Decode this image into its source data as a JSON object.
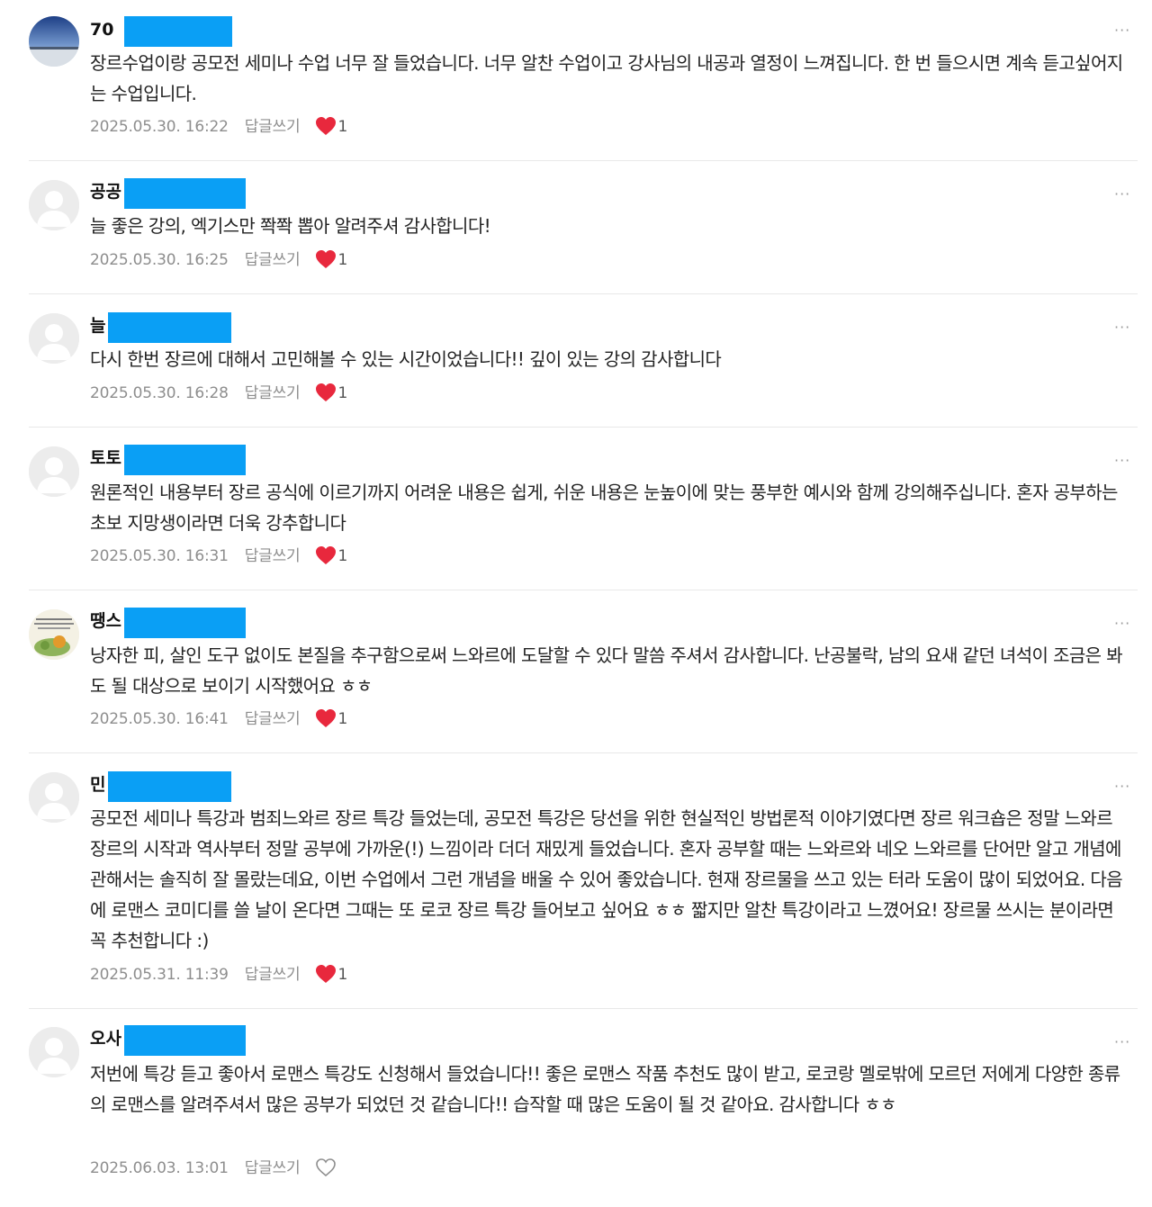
{
  "comments": [
    {
      "author": "70",
      "text": "장르수업이랑 공모전 세미나 수업 너무 잘 들었습니다. 너무 알찬 수업이고 강사님의 내공과 열정이 느껴집니다. 한 번 들으시면 계속 듣고싶어지는 수업입니다.",
      "date": "2025.05.30. 16:22",
      "reply_label": "답글쓰기",
      "likes": "1",
      "liked": true,
      "avatar": "photo-avatar-sky"
    },
    {
      "author": "공공",
      "text": "늘 좋은 강의, 엑기스만 쫙쫙 뽑아 알려주셔 감사합니다!",
      "date": "2025.05.30. 16:25",
      "reply_label": "답글쓰기",
      "likes": "1",
      "liked": true,
      "avatar": "default-avatar"
    },
    {
      "author": "늘",
      "text": "다시 한번 장르에 대해서 고민해볼 수 있는 시간이었습니다!! 깊이 있는 강의 감사합니다",
      "date": "2025.05.30. 16:28",
      "reply_label": "답글쓰기",
      "likes": "1",
      "liked": true,
      "avatar": "default-avatar"
    },
    {
      "author": "토토",
      "text": "원론적인 내용부터 장르 공식에 이르기까지 어려운 내용은 쉽게, 쉬운 내용은 눈높이에 맞는 풍부한 예시와 함께 강의해주십니다. 혼자 공부하는 초보 지망생이라면 더욱 강추합니다",
      "date": "2025.05.30. 16:31",
      "reply_label": "답글쓰기",
      "likes": "1",
      "liked": true,
      "avatar": "default-avatar"
    },
    {
      "author": "땡스",
      "text": "낭자한 피, 살인 도구 없이도 본질을 추구함으로써 느와르에 도달할 수 있다 말씀 주셔서 감사합니다. 난공불락, 남의 요새 같던 녀석이 조금은 봐도 될 대상으로 보이기 시작했어요 ㅎㅎ",
      "date": "2025.05.30. 16:41",
      "reply_label": "답글쓰기",
      "likes": "1",
      "liked": true,
      "avatar": "illustration-avatar"
    },
    {
      "author": "민",
      "text": "공모전 세미나 특강과 범죄느와르 장르 특강 들었는데, 공모전 특강은 당선을 위한 현실적인 방법론적 이야기였다면 장르 워크숍은 정말 느와르 장르의 시작과 역사부터 정말 공부에 가까운(!) 느낌이라 더더 재밌게 들었습니다. 혼자 공부할 때는 느와르와 네오 느와르를 단어만 알고 개념에 관해서는 솔직히 잘 몰랐는데요, 이번 수업에서 그런 개념을 배울 수 있어 좋았습니다. 현재 장르물을 쓰고 있는 터라 도움이 많이 되었어요. 다음에 로맨스 코미디를 쓸 날이 온다면 그때는 또 로코 장르 특강 들어보고 싶어요 ㅎㅎ 짧지만 알찬 특강이라고 느꼈어요! 장르물 쓰시는 분이라면 꼭 추천합니다 :)",
      "date": "2025.05.31. 11:39",
      "reply_label": "답글쓰기",
      "likes": "1",
      "liked": true,
      "avatar": "default-avatar"
    },
    {
      "author": "오사",
      "text": "저번에 특강 듣고 좋아서 로맨스 특강도 신청해서 들었습니다!! 좋은 로맨스 작품 추천도 많이 받고, 로코랑 멜로밖에 모르던 저에게 다양한 종류의 로맨스를 알려주셔서 많은 공부가 되었던 것 같습니다!! 습작할 때 많은 도움이 될 것 같아요. 감사합니다 ㅎㅎ",
      "date": "2025.06.03. 13:01",
      "reply_label": "답글쓰기",
      "likes": "",
      "liked": false,
      "avatar": "default-avatar"
    }
  ],
  "more_label": "···",
  "colors": {
    "redaction": "#0a9ff5",
    "heart": "#e8283d",
    "meta": "#8e8e8e"
  }
}
